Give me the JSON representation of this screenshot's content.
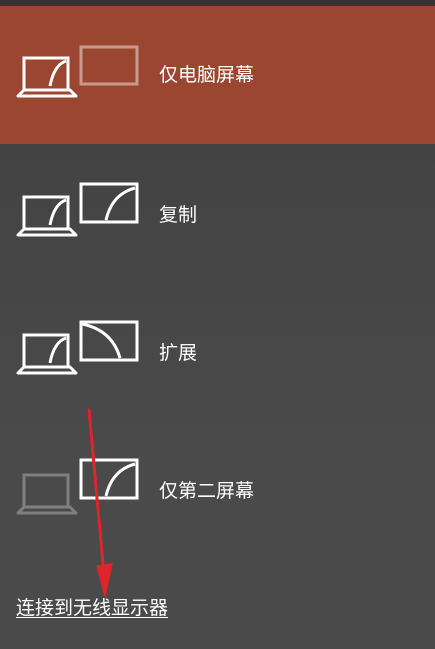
{
  "projection_menu": {
    "options": [
      {
        "label": "仅电脑屏幕",
        "icon": "pc-screen-only-icon",
        "selected": true
      },
      {
        "label": "复制",
        "icon": "duplicate-icon",
        "selected": false
      },
      {
        "label": "扩展",
        "icon": "extend-icon",
        "selected": false
      },
      {
        "label": "仅第二屏幕",
        "icon": "second-screen-only-icon",
        "selected": false
      }
    ],
    "wireless_link": "连接到无线显示器"
  },
  "colors": {
    "selected_background": "#9a4631",
    "panel_background": "#454545",
    "text": "#ffffff",
    "annotation_arrow": "#e0242a"
  }
}
